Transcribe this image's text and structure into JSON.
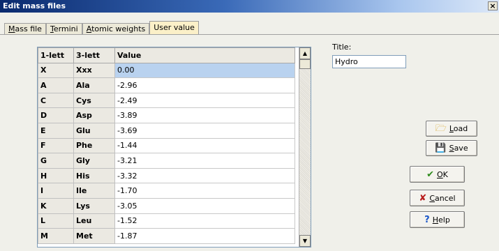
{
  "window": {
    "title": "Edit mass files",
    "close": "×"
  },
  "tabs": [
    {
      "label": "Mass file",
      "key": "M",
      "rest": "ass file"
    },
    {
      "label": "Termini",
      "key": "T",
      "rest": "ermini"
    },
    {
      "label": "Atomic weights",
      "key": "A",
      "rest": "tomic weights"
    },
    {
      "label": "User value"
    }
  ],
  "table": {
    "headers": [
      "1-lett",
      "3-lett",
      "Value"
    ],
    "rows": [
      [
        "X",
        "Xxx",
        "0.00"
      ],
      [
        "A",
        "Ala",
        "-2.96"
      ],
      [
        "C",
        "Cys",
        "-2.49"
      ],
      [
        "D",
        "Asp",
        "-3.89"
      ],
      [
        "E",
        "Glu",
        "-3.69"
      ],
      [
        "F",
        "Phe",
        "-1.44"
      ],
      [
        "G",
        "Gly",
        "-3.21"
      ],
      [
        "H",
        "His",
        "-3.32"
      ],
      [
        "I",
        "Ile",
        "-1.70"
      ],
      [
        "K",
        "Lys",
        "-3.05"
      ],
      [
        "L",
        "Leu",
        "-1.52"
      ],
      [
        "M",
        "Met",
        "-1.87"
      ]
    ]
  },
  "title_field": {
    "label": "Title:",
    "value": "Hydro"
  },
  "buttons": {
    "load": {
      "key": "L",
      "rest": "oad",
      "icon": "folder-open-icon"
    },
    "save": {
      "key": "S",
      "rest": "ave",
      "icon": "floppy-disk-icon"
    },
    "ok": {
      "key": "O",
      "rest": "K",
      "icon": "checkmark-icon"
    },
    "cancel": {
      "key": "C",
      "rest": "ancel",
      "icon": "x-mark-icon"
    },
    "help": {
      "key": "H",
      "rest": "elp",
      "icon": "question-mark-icon"
    }
  }
}
